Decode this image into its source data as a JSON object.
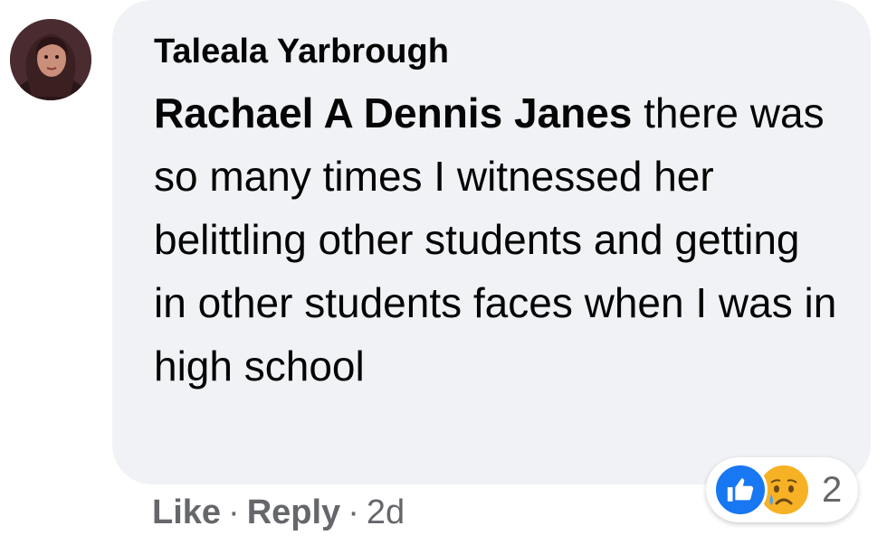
{
  "comment": {
    "author": "Taleala Yarbrough",
    "mention": "Rachael A Dennis Janes",
    "text": " there was so many times I witnessed her belittling other students and getting in other students faces when I was in high school",
    "actions": {
      "like_label": "Like",
      "reply_label": "Reply",
      "separator": "·",
      "timestamp": "2d"
    },
    "reactions": {
      "icons": [
        "like-icon",
        "sad-icon"
      ],
      "count": "2"
    }
  },
  "colors": {
    "bubble": "#f0f2f5",
    "text": "#050505",
    "secondary_text": "#65676b",
    "like_blue": "#1877f2",
    "sad_yellow": "#f7b125"
  }
}
